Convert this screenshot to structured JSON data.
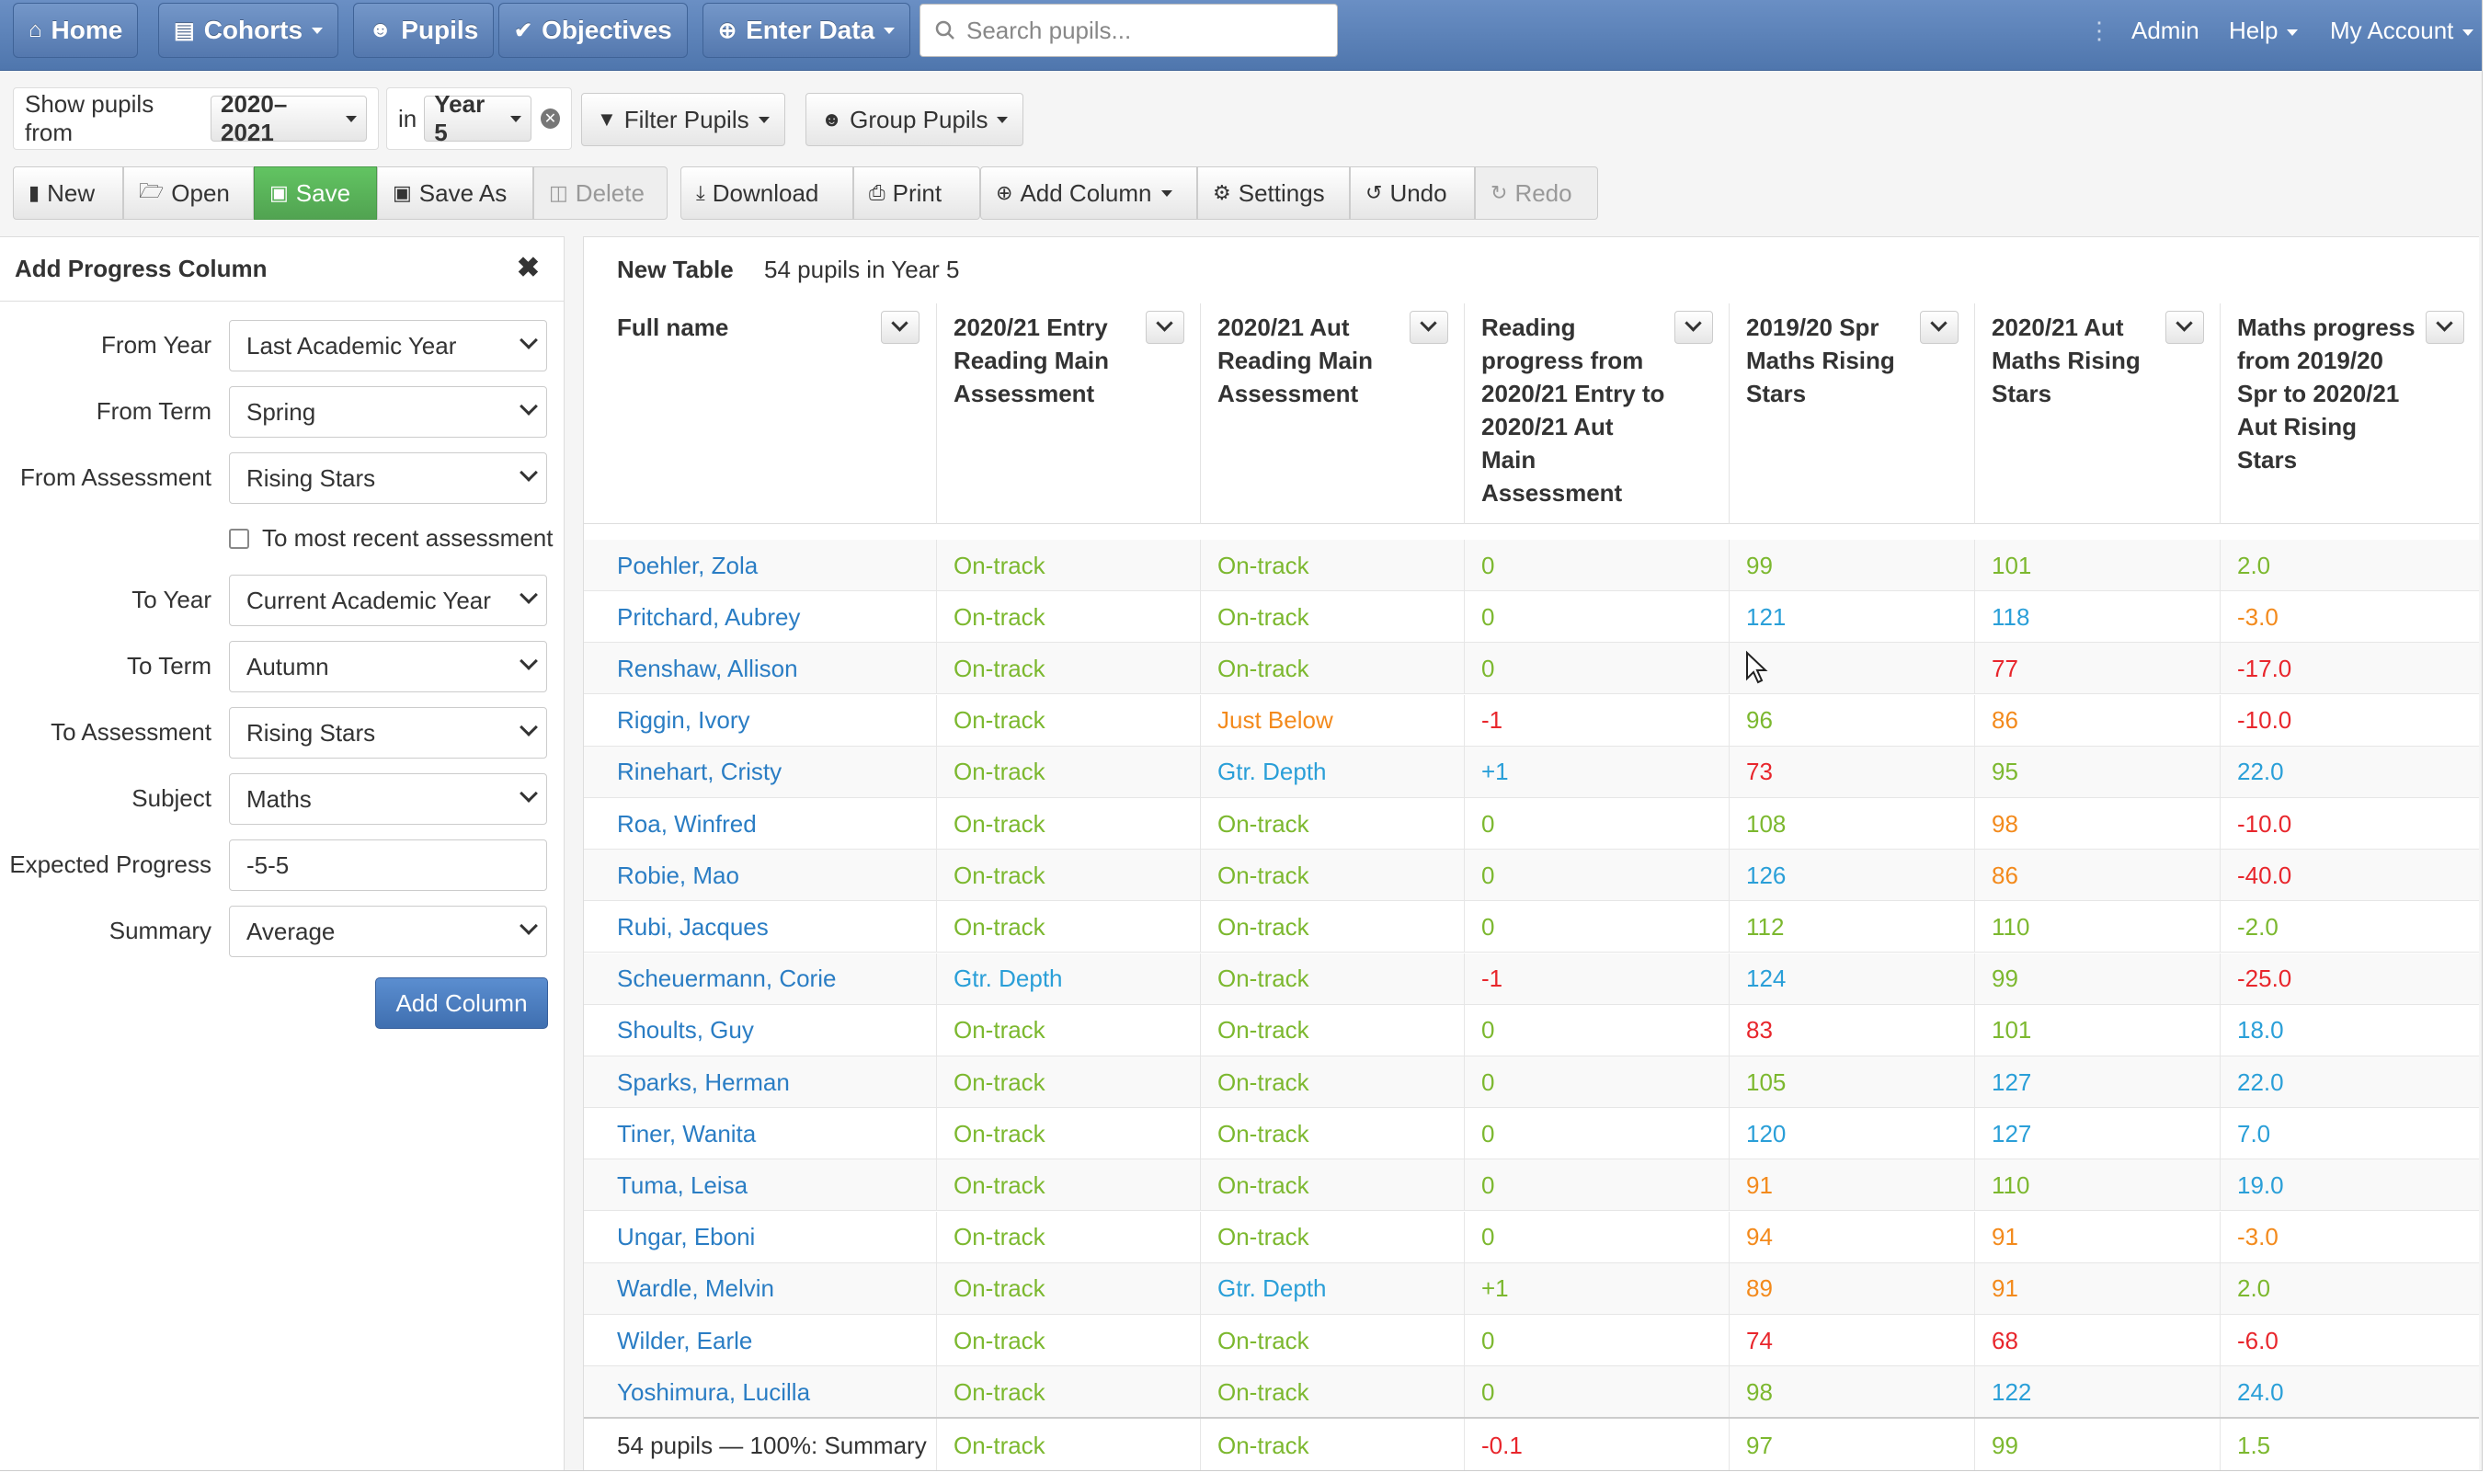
{
  "nav": {
    "home": "Home",
    "cohorts": "Cohorts",
    "pupils": "Pupils",
    "objectives": "Objectives",
    "enter_data": "Enter Data",
    "search_placeholder": "Search pupils...",
    "admin": "Admin",
    "help": "Help",
    "my_account": "My Account"
  },
  "filters": {
    "show_label": "Show pupils from",
    "year_range": "2020–2021",
    "in_label": "in",
    "year_group": "Year 5",
    "filter_pupils": "Filter Pupils",
    "group_pupils": "Group Pupils"
  },
  "toolbar": {
    "new": "New",
    "open": "Open",
    "save": "Save",
    "save_as": "Save As",
    "delete": "Delete",
    "download": "Download",
    "print": "Print",
    "add_column": "Add Column",
    "settings": "Settings",
    "undo": "Undo",
    "redo": "Redo"
  },
  "panel": {
    "title": "Add Progress Column",
    "from_year_label": "From Year",
    "from_year": "Last Academic Year",
    "from_term_label": "From Term",
    "from_term": "Spring",
    "from_assessment_label": "From Assessment",
    "from_assessment": "Rising Stars",
    "most_recent_label": "To most recent assessment",
    "to_year_label": "To Year",
    "to_year": "Current Academic Year",
    "to_term_label": "To Term",
    "to_term": "Autumn",
    "to_assessment_label": "To Assessment",
    "to_assessment": "Rising Stars",
    "subject_label": "Subject",
    "subject": "Maths",
    "expected_label": "Expected Progress",
    "expected": "-5-5",
    "summary_label": "Summary",
    "summary": "Average",
    "add_button": "Add Column"
  },
  "table": {
    "title": "New Table",
    "count": "54 pupils in Year 5",
    "columns": [
      "Full name",
      "2020/21 Entry Reading Main Assessment",
      "2020/21 Aut Reading Main Assessment",
      "Reading progress from 2020/21 Entry to 2020/21 Aut Main Assessment",
      "2019/20 Spr Maths Rising Stars",
      "2020/21 Aut Maths Rising Stars",
      "Maths progress from 2019/20 Spr to 2020/21 Aut Rising Stars"
    ],
    "rows": [
      {
        "name": "Poehler, Zola",
        "entry": "On-track",
        "aut": "On-track",
        "rprog": "0",
        "spr": "99",
        "maut": "101",
        "mprog": "2.0",
        "cls": [
          "green",
          "green",
          "green",
          "green",
          "green",
          "green"
        ]
      },
      {
        "name": "Pritchard, Aubrey",
        "entry": "On-track",
        "aut": "On-track",
        "rprog": "0",
        "spr": "121",
        "maut": "118",
        "mprog": "-3.0",
        "cls": [
          "green",
          "green",
          "green",
          "blue",
          "blue",
          "orange"
        ]
      },
      {
        "name": "Renshaw, Allison",
        "entry": "On-track",
        "aut": "On-track",
        "rprog": "0",
        "spr": "",
        "maut": "77",
        "mprog": "-17.0",
        "cls": [
          "green",
          "green",
          "green",
          "green",
          "red",
          "red"
        ]
      },
      {
        "name": "Riggin, Ivory",
        "entry": "On-track",
        "aut": "Just Below",
        "rprog": "-1",
        "spr": "96",
        "maut": "86",
        "mprog": "-10.0",
        "cls": [
          "green",
          "orange",
          "red",
          "green",
          "orange",
          "red"
        ]
      },
      {
        "name": "Rinehart, Cristy",
        "entry": "On-track",
        "aut": "Gtr. Depth",
        "rprog": "+1",
        "spr": "73",
        "maut": "95",
        "mprog": "22.0",
        "cls": [
          "green",
          "blue",
          "blue",
          "red",
          "green",
          "blue"
        ]
      },
      {
        "name": "Roa, Winfred",
        "entry": "On-track",
        "aut": "On-track",
        "rprog": "0",
        "spr": "108",
        "maut": "98",
        "mprog": "-10.0",
        "cls": [
          "green",
          "green",
          "green",
          "green",
          "orange",
          "red"
        ]
      },
      {
        "name": "Robie, Mao",
        "entry": "On-track",
        "aut": "On-track",
        "rprog": "0",
        "spr": "126",
        "maut": "86",
        "mprog": "-40.0",
        "cls": [
          "green",
          "green",
          "green",
          "blue",
          "orange",
          "red"
        ]
      },
      {
        "name": "Rubi, Jacques",
        "entry": "On-track",
        "aut": "On-track",
        "rprog": "0",
        "spr": "112",
        "maut": "110",
        "mprog": "-2.0",
        "cls": [
          "green",
          "green",
          "green",
          "green",
          "green",
          "green"
        ]
      },
      {
        "name": "Scheuermann, Corie",
        "entry": "Gtr. Depth",
        "aut": "On-track",
        "rprog": "-1",
        "spr": "124",
        "maut": "99",
        "mprog": "-25.0",
        "cls": [
          "blue",
          "green",
          "red",
          "blue",
          "green",
          "red"
        ]
      },
      {
        "name": "Shoults, Guy",
        "entry": "On-track",
        "aut": "On-track",
        "rprog": "0",
        "spr": "83",
        "maut": "101",
        "mprog": "18.0",
        "cls": [
          "green",
          "green",
          "green",
          "red",
          "green",
          "blue"
        ]
      },
      {
        "name": "Sparks, Herman",
        "entry": "On-track",
        "aut": "On-track",
        "rprog": "0",
        "spr": "105",
        "maut": "127",
        "mprog": "22.0",
        "cls": [
          "green",
          "green",
          "green",
          "green",
          "blue",
          "blue"
        ]
      },
      {
        "name": "Tiner, Wanita",
        "entry": "On-track",
        "aut": "On-track",
        "rprog": "0",
        "spr": "120",
        "maut": "127",
        "mprog": "7.0",
        "cls": [
          "green",
          "green",
          "green",
          "blue",
          "blue",
          "blue"
        ]
      },
      {
        "name": "Tuma, Leisa",
        "entry": "On-track",
        "aut": "On-track",
        "rprog": "0",
        "spr": "91",
        "maut": "110",
        "mprog": "19.0",
        "cls": [
          "green",
          "green",
          "green",
          "orange",
          "green",
          "blue"
        ]
      },
      {
        "name": "Ungar, Eboni",
        "entry": "On-track",
        "aut": "On-track",
        "rprog": "0",
        "spr": "94",
        "maut": "91",
        "mprog": "-3.0",
        "cls": [
          "green",
          "green",
          "green",
          "orange",
          "orange",
          "orange"
        ]
      },
      {
        "name": "Wardle, Melvin",
        "entry": "On-track",
        "aut": "Gtr. Depth",
        "rprog": "+1",
        "spr": "89",
        "maut": "91",
        "mprog": "2.0",
        "cls": [
          "green",
          "blue",
          "green",
          "orange",
          "orange",
          "green"
        ]
      },
      {
        "name": "Wilder, Earle",
        "entry": "On-track",
        "aut": "On-track",
        "rprog": "0",
        "spr": "74",
        "maut": "68",
        "mprog": "-6.0",
        "cls": [
          "green",
          "green",
          "green",
          "red",
          "red",
          "red"
        ]
      },
      {
        "name": "Yoshimura, Lucilla",
        "entry": "On-track",
        "aut": "On-track",
        "rprog": "0",
        "spr": "98",
        "maut": "122",
        "mprog": "24.0",
        "cls": [
          "green",
          "green",
          "green",
          "green",
          "blue",
          "blue"
        ]
      }
    ],
    "summary": {
      "name": "54 pupils — 100%: Summary",
      "entry": "On-track",
      "aut": "On-track",
      "rprog": "-0.1",
      "spr": "97",
      "maut": "99",
      "mprog": "1.5",
      "cls": [
        "green",
        "green",
        "red",
        "green",
        "green",
        "green"
      ]
    }
  },
  "colors": {
    "green": "#7cb82f",
    "blue": "#2a9fd8",
    "orange": "#f38a1c",
    "red": "#e8262c",
    "navbar": "#5a80b8",
    "link": "#2a7dc4"
  }
}
